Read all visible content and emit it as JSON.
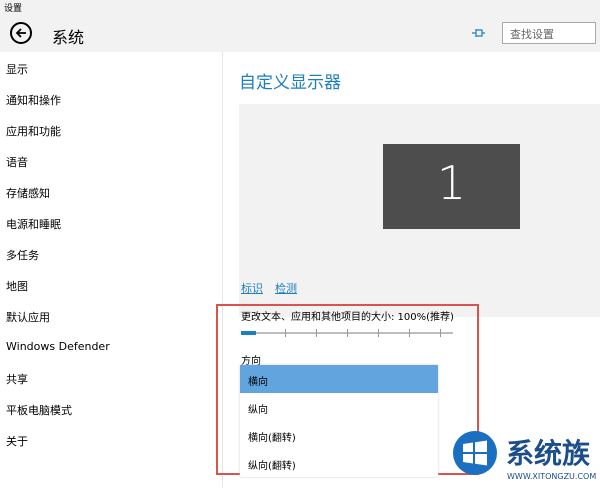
{
  "window": {
    "title": "设置"
  },
  "header": {
    "title": "系统",
    "search_placeholder": "查找设置"
  },
  "sidebar": {
    "items": [
      {
        "label": "显示"
      },
      {
        "label": "通知和操作"
      },
      {
        "label": "应用和功能"
      },
      {
        "label": "语音"
      },
      {
        "label": "存储感知"
      },
      {
        "label": "电源和睡眠"
      },
      {
        "label": "多任务"
      },
      {
        "label": "地图"
      },
      {
        "label": "默认应用"
      },
      {
        "label": "Windows Defender"
      },
      {
        "label": "共享"
      },
      {
        "label": "平板电脑模式"
      },
      {
        "label": "关于"
      }
    ]
  },
  "main": {
    "heading": "自定义显示器",
    "monitor_number": "1",
    "identify_link": "标识",
    "detect_link": "检测",
    "scale_label": "更改文本、应用和其他项目的大小: 100%(推荐)",
    "scale_fraction": 0.07,
    "orientation_label": "方向",
    "orientation_options": [
      {
        "label": "横向",
        "selected": true
      },
      {
        "label": "纵向",
        "selected": false
      },
      {
        "label": "横向(翻转)",
        "selected": false
      },
      {
        "label": "纵向(翻转)",
        "selected": false
      }
    ]
  },
  "watermark": {
    "text": "系统族",
    "url": "WWW.XITONGZU.COM"
  },
  "colors": {
    "accent": "#1c7fbf",
    "selection": "#62a5de",
    "highlight_box": "#d9534f"
  }
}
